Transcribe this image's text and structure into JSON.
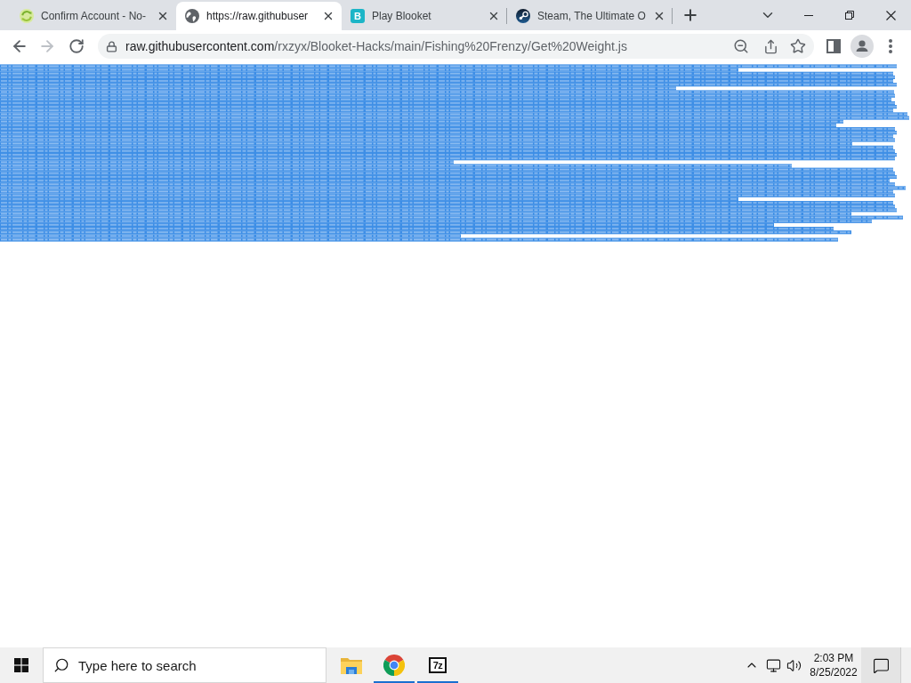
{
  "tabs": [
    {
      "title": "Confirm Account - No-",
      "favicon": {
        "kind": "sync"
      },
      "selected": false
    },
    {
      "title": "https://raw.githubuser",
      "favicon": {
        "kind": "globe"
      },
      "selected": true
    },
    {
      "title": "Play Blooket",
      "favicon": {
        "kind": "letter",
        "letter": "B"
      },
      "selected": false
    },
    {
      "title": "Steam, The Ultimate O",
      "favicon": {
        "kind": "disc"
      },
      "selected": false
    }
  ],
  "toolbar": {
    "nav_buttons": [
      {
        "kind": "back",
        "disabled": false
      },
      {
        "kind": "forward",
        "disabled": true
      },
      {
        "kind": "reload",
        "disabled": false
      }
    ],
    "address": {
      "host": "raw.githubusercontent.com",
      "path": "/rxzyx/Blooket-Hacks/main/Fishing%20Frenzy/Get%20Weight.js"
    }
  },
  "taskbar": {
    "search": {
      "placeholder": "Type here to search"
    },
    "apps": [
      {
        "kind": "folder",
        "running": false
      },
      {
        "kind": "browser",
        "running": true
      },
      {
        "kind": "archiver",
        "label": "7z",
        "running": true
      }
    ],
    "clock": {
      "time": "2:03 PM",
      "date": "8/25/2022"
    }
  }
}
